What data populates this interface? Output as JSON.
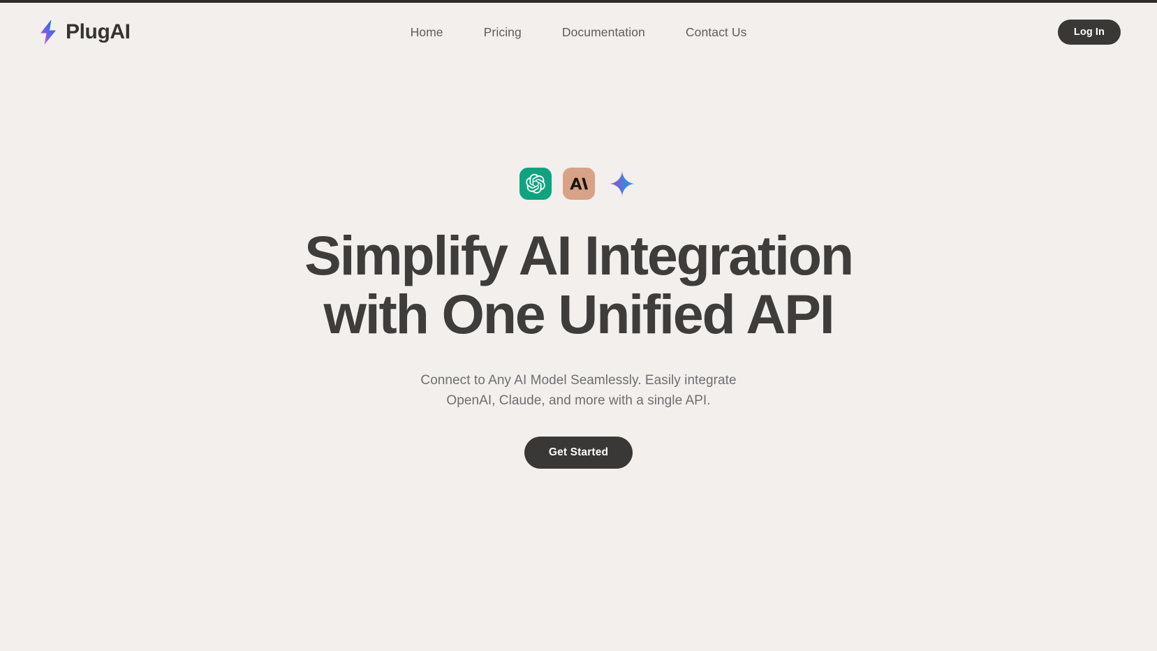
{
  "theme": {
    "background": "#f2efed",
    "text_dark": "#3e3d3b",
    "text_muted": "#6f6d72",
    "nav_text": "#5f5d5b",
    "button_dark": "#3a3836",
    "openai_green": "#10a37f",
    "anthropic_tan": "#d7a285",
    "gemini_purple": "#8b5cf6",
    "gemini_blue": "#3b82f6",
    "bolt_gradient_start": "#e879c7",
    "bolt_gradient_end": "#1668e3"
  },
  "header": {
    "brand_name": "PlugAI",
    "logo_icon": "lightning-bolt-icon",
    "nav": [
      {
        "label": "Home"
      },
      {
        "label": "Pricing"
      },
      {
        "label": "Documentation"
      },
      {
        "label": "Contact Us"
      }
    ],
    "login_label": "Log In"
  },
  "hero": {
    "model_icons": [
      {
        "name": "openai-icon",
        "label": "OpenAI"
      },
      {
        "name": "anthropic-icon",
        "label": "Anthropic"
      },
      {
        "name": "gemini-icon",
        "label": "Gemini"
      }
    ],
    "title_line_1": "Simplify AI Integration",
    "title_line_2": "with One Unified API",
    "subtitle_line_1": "Connect to Any AI Model Seamlessly. Easily integrate",
    "subtitle_line_2": "OpenAI, Claude, and more with a single API.",
    "cta_label": "Get Started"
  }
}
